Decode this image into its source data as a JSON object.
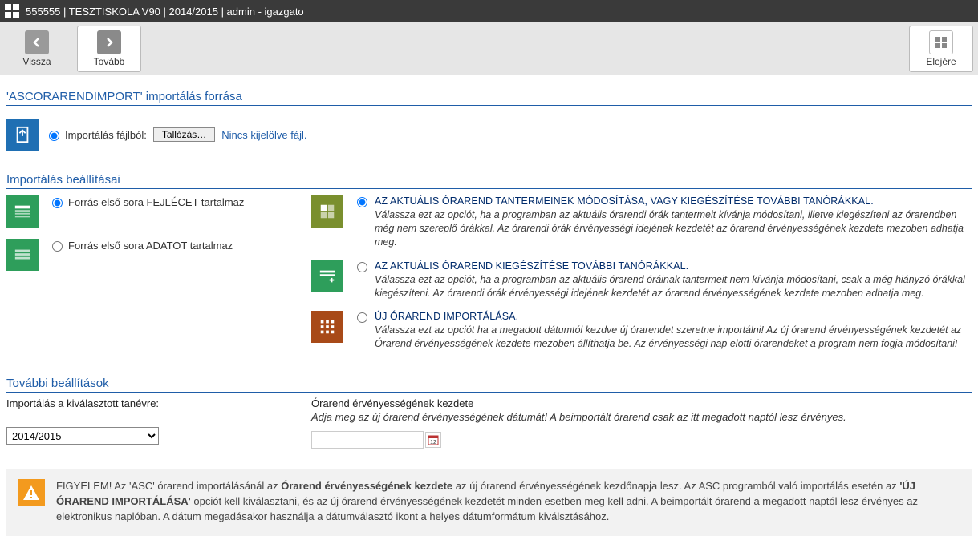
{
  "titlebar": "555555 | TESZTISKOLA V90 | 2014/2015 |  admin - igazgato",
  "toolbar": {
    "back": "Vissza",
    "next": "Tovább",
    "top": "Elejére"
  },
  "source": {
    "heading": "'ASCORARENDIMPORT' importálás forrása",
    "from_file_label": "Importálás fájlból:",
    "browse": "Tallózás…",
    "no_file": "Nincs kijelölve fájl."
  },
  "settings": {
    "heading": "Importálás beállításai",
    "left_header": "Forrás első sora FEJLÉCET tartalmaz",
    "left_data": "Forrás első sora ADATOT tartalmaz",
    "opt1_title": "AZ AKTUÁLIS ÓRAREND TANTERMEINEK MÓDOSÍTÁSA, VAGY KIEGÉSZÍTÉSE TOVÁBBI TANÓRÁKKAL.",
    "opt1_desc": "Válassza ezt az opciót, ha a programban az aktuális órarendi órák tantermeit kívánja módosítani, illetve kiegészíteni az órarendben még nem szereplő órákkal. Az órarendi órák érvényességi idejének kezdetét az órarend érvényességének kezdete mezoben adhatja meg.",
    "opt2_title": "AZ AKTUÁLIS ÓRAREND KIEGÉSZÍTÉSE TOVÁBBI TANÓRÁKKAL.",
    "opt2_desc": "Válassza ezt az opciót, ha a programban az aktuális órarend óráinak tantermeit nem kívánja módosítani, csak a még hiányzó órákkal kiegészíteni. Az órarendi órák érvényességi idejének kezdetét az órarend érvényességének kezdete mezoben adhatja meg.",
    "opt3_title": "ÚJ ÓRAREND IMPORTÁLÁSA.",
    "opt3_desc": "Válassza ezt az opciót ha a megadott dátumtól kezdve új órarendet szeretne importálni! Az új órarend érvényességének kezdetét az Órarend érvényességének kezdete mezoben állíthatja be. Az érvényességi nap elotti órarendeket a program nem fogja módosítani!"
  },
  "further": {
    "heading": "További beállítások",
    "year_label": "Importálás a kiválasztott tanévre:",
    "year_value": "2014/2015",
    "date_label": "Órarend érvényességének kezdete",
    "date_help": "Adja meg az új órarend érvényességének dátumát! A beimportált órarend csak az itt megadott naptól lesz érvényes.",
    "date_value": ""
  },
  "alert": {
    "attn": "FIGYELEM!",
    "p1a": " Az 'ASC' órarend importálásánál az ",
    "b1": "Órarend érvényességének kezdete",
    "p1b": " az új órarend érvényességének kezdőnapja lesz. Az ASC programból való importálás esetén az ",
    "b2": "'ÚJ ÓRAREND IMPORTÁLÁSA'",
    "p2": " opciót kell kiválasztani, és az új órarend érvényességének kezdetét minden esetben meg kell adni. A beimportált órarend a megadott naptól lesz érvényes az elektronikus naplóban. A dátum megadásakor használja a dátumválasztó ikont a helyes dátumformátum kiválsztásához."
  }
}
